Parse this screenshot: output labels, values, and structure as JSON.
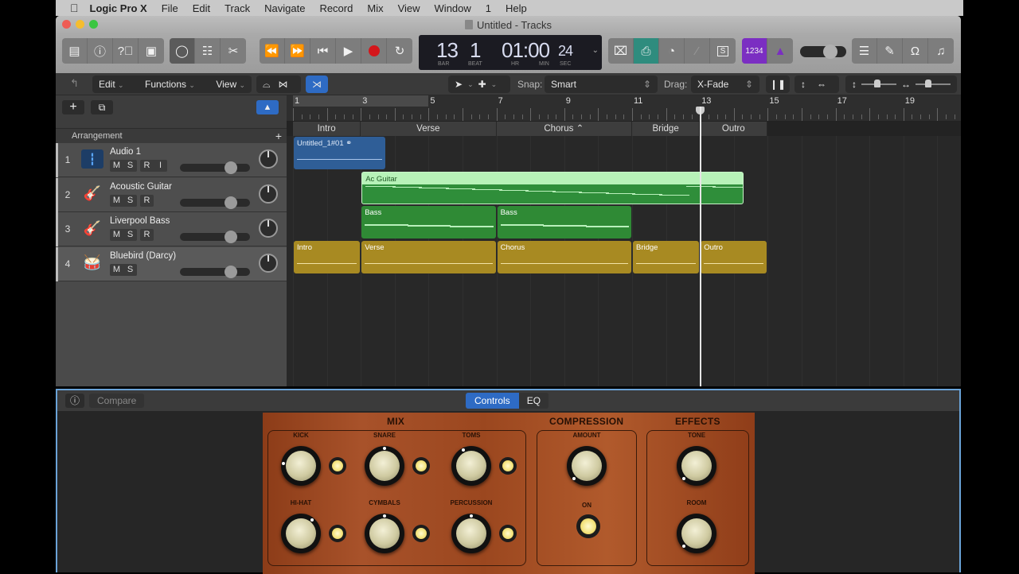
{
  "menubar": {
    "apple": "",
    "app_name": "Logic Pro X",
    "items": [
      "File",
      "Edit",
      "Track",
      "Navigate",
      "Record",
      "Mix",
      "View",
      "Window",
      "1",
      "Help"
    ]
  },
  "window": {
    "title": "Untitled - Tracks"
  },
  "control_bar": {
    "left_buttons": [
      "library-icon",
      "inspector-icon",
      "quick-help-icon",
      "toolbar-icon"
    ],
    "view_buttons": [
      "smart-controls-icon",
      "mixer-icon",
      "editors-icon"
    ],
    "transport": [
      "rewind-icon",
      "fast-forward-icon",
      "go-to-beginning-icon",
      "play-icon",
      "record-icon",
      "cycle-icon"
    ],
    "lcd": {
      "bar": "13",
      "beat": "1",
      "time": "01:00",
      "sec": "24",
      "labels": {
        "bar": "BAR",
        "beat": "BEAT",
        "hr": "HR",
        "min": "MIN",
        "sec": "SEC"
      }
    },
    "mode_buttons": [
      "replace-icon",
      "autopunch-icon",
      "tuner-icon",
      "tuning-fork-icon",
      "solo-icon"
    ],
    "count_in": "1234",
    "metronome": "metronome-icon",
    "master_volume": 0.78,
    "right_buttons": [
      "list-editors-icon",
      "notepad-icon",
      "loop-browser-icon",
      "browsers-icon"
    ]
  },
  "tracks_toolbar": {
    "menus": [
      "Edit",
      "Functions",
      "View"
    ],
    "snap_label": "Snap:",
    "snap_value": "Smart",
    "drag_label": "Drag:",
    "drag_value": "X-Fade",
    "vertical_zoom": 0.3,
    "horizontal_zoom": 0.25
  },
  "track_header": {
    "arrangement_label": "Arrangement"
  },
  "tracks": [
    {
      "num": "1",
      "name": "Audio 1",
      "buttons": [
        "M",
        "S",
        "R",
        "I"
      ],
      "icon": "waveform-icon",
      "volume": 0.7
    },
    {
      "num": "2",
      "name": "Acoustic Guitar",
      "buttons": [
        "M",
        "S",
        "R"
      ],
      "icon": "acoustic-guitar-icon",
      "volume": 0.7
    },
    {
      "num": "3",
      "name": "Liverpool Bass",
      "buttons": [
        "M",
        "S",
        "R"
      ],
      "icon": "bass-guitar-icon",
      "volume": 0.7
    },
    {
      "num": "4",
      "name": "Bluebird (Darcy)",
      "buttons": [
        "M",
        "S"
      ],
      "icon": "drum-kit-icon",
      "volume": 0.7
    }
  ],
  "ruler": {
    "bars": [
      "1",
      "3",
      "5",
      "7",
      "9",
      "11",
      "13",
      "15",
      "17",
      "19"
    ],
    "playhead_bar": 13,
    "cycle": {
      "start": 1,
      "end": 5
    }
  },
  "arrangement_markers": [
    {
      "label": "Intro",
      "start": 1,
      "end": 3
    },
    {
      "label": "Verse",
      "start": 3,
      "end": 7
    },
    {
      "label": "Chorus ⌃",
      "start": 7,
      "end": 11
    },
    {
      "label": "Bridge",
      "start": 11,
      "end": 13
    },
    {
      "label": "Outro",
      "start": 13,
      "end": 15
    }
  ],
  "regions": [
    {
      "track": 1,
      "label": "Untitled_1#01",
      "start": 1,
      "end": 3.75,
      "kind": "audio",
      "color": "#2f5e97"
    },
    {
      "track": 2,
      "label": "Ac Guitar",
      "start": 3,
      "end": 14.3,
      "kind": "midi",
      "color": "#2f8e3a",
      "header": "#b7f2b8"
    },
    {
      "track": 3,
      "label": "Bass",
      "start": 3,
      "end": 7,
      "kind": "midi",
      "color": "#2f8a35"
    },
    {
      "track": 3,
      "label": "Bass",
      "start": 7,
      "end": 11,
      "kind": "midi",
      "color": "#2f8a35"
    },
    {
      "track": 4,
      "label": "Intro",
      "start": 1,
      "end": 3,
      "kind": "drummer",
      "color": "#a88a22"
    },
    {
      "track": 4,
      "label": "Verse",
      "start": 3,
      "end": 7,
      "kind": "drummer",
      "color": "#a88a22"
    },
    {
      "track": 4,
      "label": "Chorus",
      "start": 7,
      "end": 11,
      "kind": "drummer",
      "color": "#a88a22"
    },
    {
      "track": 4,
      "label": "Bridge",
      "start": 11,
      "end": 13,
      "kind": "drummer",
      "color": "#a88a22"
    },
    {
      "track": 4,
      "label": "Outro",
      "start": 13,
      "end": 15,
      "kind": "drummer",
      "color": "#a88a22"
    }
  ],
  "smart_controls": {
    "compare_label": "Compare",
    "tabs": [
      "Controls",
      "EQ"
    ],
    "active_tab": "Controls",
    "sections": {
      "mix": "MIX",
      "compression": "COMPRESSION",
      "effects": "EFFECTS"
    },
    "mix_knobs": [
      {
        "label": "KICK",
        "value": 0.2,
        "lamp_on": true
      },
      {
        "label": "SNARE",
        "value": 0.5,
        "lamp_on": true
      },
      {
        "label": "TOMS",
        "value": 0.4,
        "lamp_on": true
      },
      {
        "label": "HI-HAT",
        "value": 0.65,
        "lamp_on": true
      },
      {
        "label": "CYMBALS",
        "value": 0.5,
        "lamp_on": true
      },
      {
        "label": "PERCUSSION",
        "value": 0.5,
        "lamp_on": true
      }
    ],
    "compression": {
      "amount_label": "AMOUNT",
      "amount": 0.0,
      "on_label": "ON",
      "on": true
    },
    "effects": {
      "tone_label": "TONE",
      "tone": 0.0,
      "room_label": "ROOM",
      "room": 0.0
    }
  }
}
